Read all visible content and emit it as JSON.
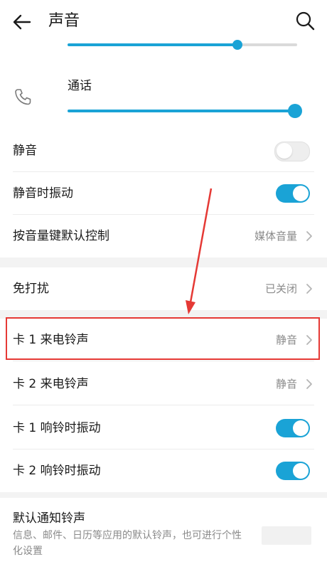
{
  "header": {
    "title": "声音",
    "back_icon": "arrow-left-icon",
    "search_icon": "search-icon"
  },
  "volume_sliders": {
    "media_level": 0.74,
    "call": {
      "label": "通话",
      "icon": "phone-icon",
      "level": 1.0
    }
  },
  "rows": {
    "mute": {
      "label": "静音",
      "on": false
    },
    "vibrate_on_mute": {
      "label": "静音时振动",
      "on": true
    },
    "volume_key": {
      "label": "按音量键默认控制",
      "value": "媒体音量"
    },
    "dnd": {
      "label": "免打扰",
      "value": "已关闭"
    },
    "sim1_ringtone": {
      "label": "卡 1 来电铃声",
      "value": "静音"
    },
    "sim2_ringtone": {
      "label": "卡 2 来电铃声",
      "value": "静音"
    },
    "sim1_vibrate": {
      "label": "卡 1 响铃时振动",
      "on": true
    },
    "sim2_vibrate": {
      "label": "卡 2 响铃时振动",
      "on": true
    }
  },
  "notification": {
    "label": "默认通知铃声",
    "description": "信息、邮件、日历等应用的默认铃声，也可进行个性化设置"
  },
  "colors": {
    "accent": "#1aa3d6",
    "annotation": "#e53935",
    "section_gap": "#f3f3f3"
  }
}
